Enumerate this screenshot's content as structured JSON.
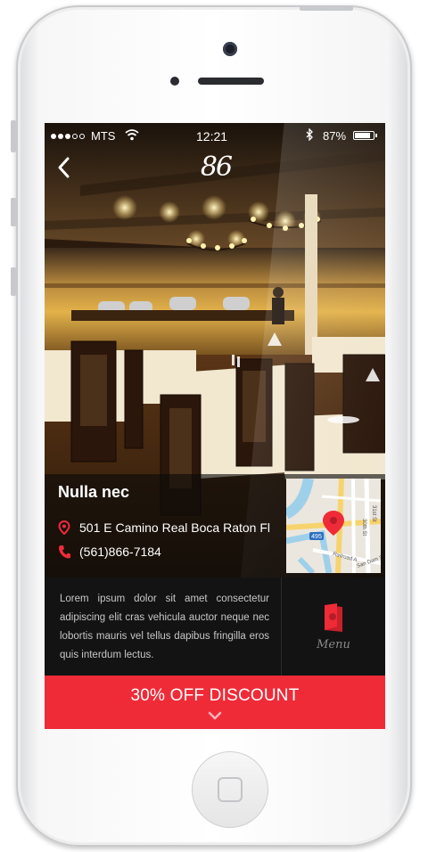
{
  "status_bar": {
    "carrier": "MTS",
    "time": "12:21",
    "battery": "87%",
    "battery_level": 0.87
  },
  "header": {
    "back_icon": "chevron-left-icon",
    "logo": "86"
  },
  "restaurant": {
    "name": "Nulla nec",
    "address": "501 E Camino Real Boca Raton Fl",
    "phone": "(561)866-7184"
  },
  "map": {
    "labels": [
      "495",
      "30th St",
      "Railroad A",
      "San Dam St",
      "31st St"
    ]
  },
  "description": {
    "text": "Lorem ipsum dolor sit amet consectetur adipiscing elit cras vehicula auctor neque nec lobortis mauris vel tellus dapibus fringilla eros quis interdum lectus."
  },
  "menu_button": {
    "label": "Menu",
    "icon": "menu-book-icon"
  },
  "discount": {
    "label": "30% OFF DISCOUNT",
    "icon": "chevron-down-icon"
  },
  "colors": {
    "accent": "#ef2b38",
    "dark_panel": "#131313"
  }
}
